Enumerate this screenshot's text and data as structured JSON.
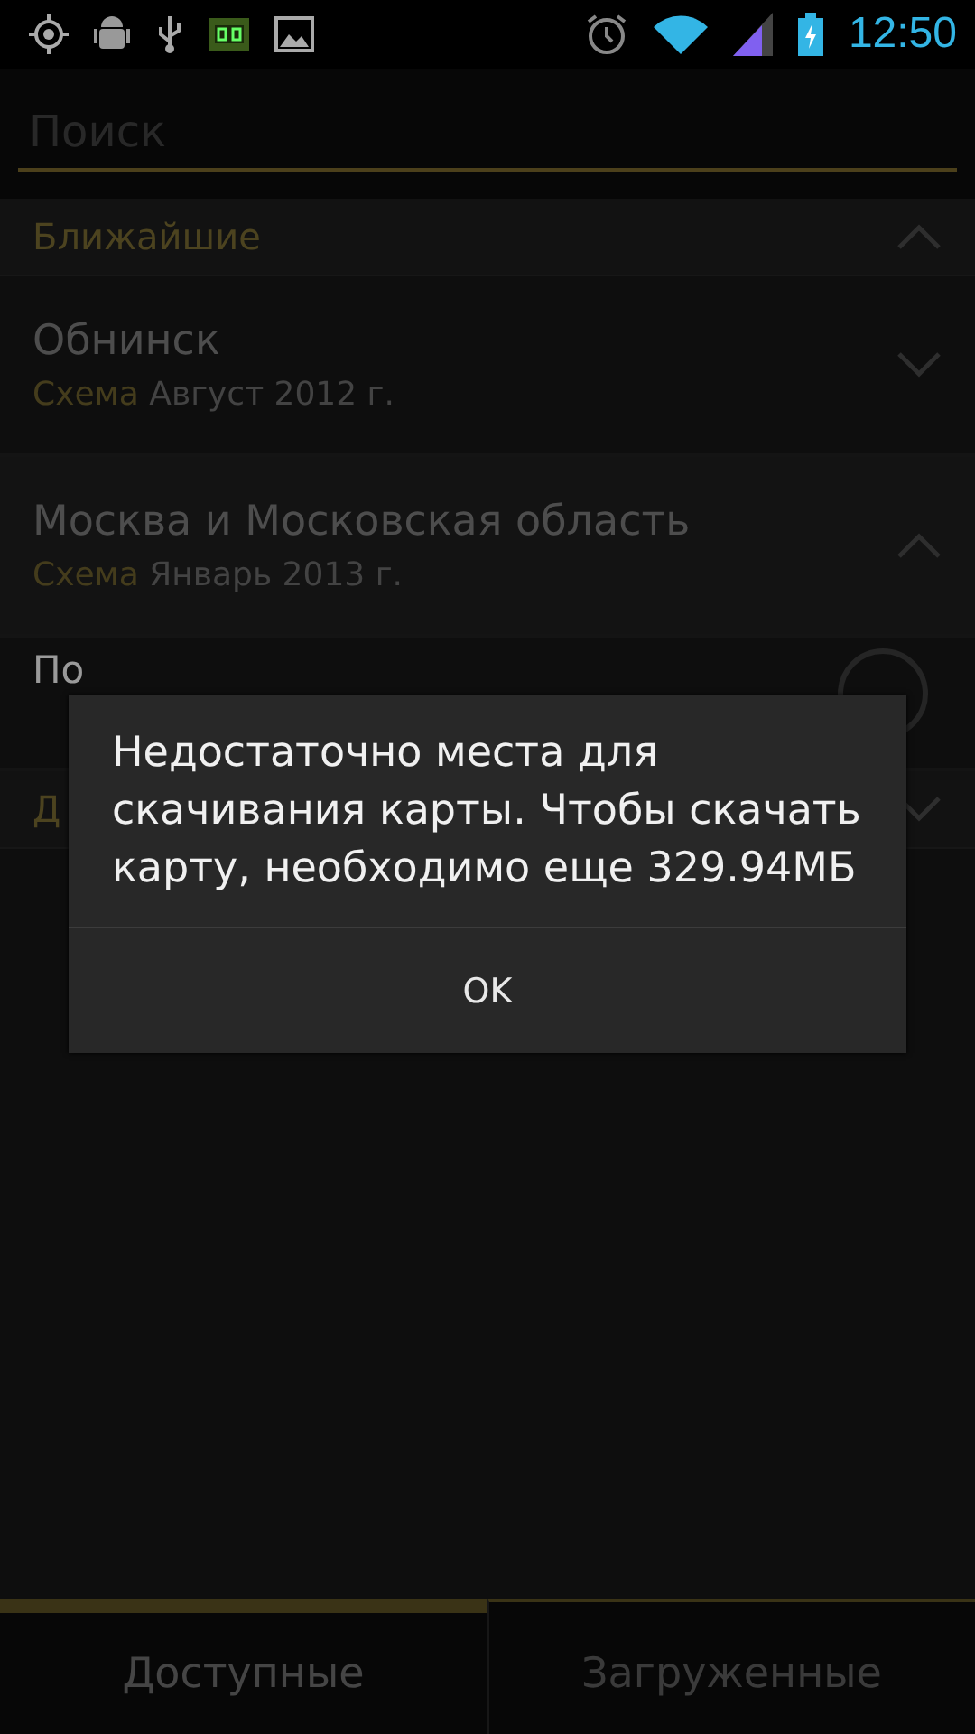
{
  "status_bar": {
    "time": "12:50"
  },
  "search": {
    "placeholder": "Поиск"
  },
  "sections": [
    {
      "title": "Ближайшие",
      "expanded": true,
      "items": [
        {
          "name": "Обнинск",
          "type": "Схема",
          "date": "Август 2012 г.",
          "expanded": false
        },
        {
          "name": "Москва и Московская область",
          "type": "Схема",
          "date": "Январь 2013 г.",
          "expanded": true,
          "children": [
            {
              "name": "По"
            }
          ]
        }
      ]
    },
    {
      "title": "Д",
      "expanded": false
    }
  ],
  "dialog": {
    "message": "Недостаточно места для скачивания карты. Чтобы скачать карту, необходимо еще 329.94МБ",
    "buttons": [
      "OK"
    ]
  },
  "tabs": [
    {
      "label": "Доступные",
      "selected": true
    },
    {
      "label": "Загруженные",
      "selected": false
    }
  ]
}
